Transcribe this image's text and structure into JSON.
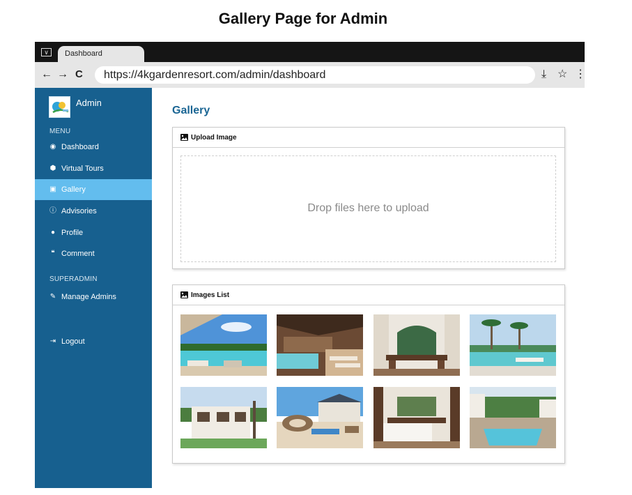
{
  "caption": "Gallery Page for Admin",
  "browser": {
    "tab_title": "Dashboard",
    "url": "https://4kgardenresort.com/admin/dashboard",
    "nav": {
      "back": "←",
      "forward": "→",
      "reload": "C"
    },
    "tools": {
      "download": "⤓",
      "bookmark": "☆",
      "more": "⋮"
    },
    "window_menu_icon": "∨"
  },
  "sidebar": {
    "brand": "Admin",
    "menu_label": "MENU",
    "items": [
      {
        "label": "Dashboard",
        "icon": "dashboard-icon",
        "glyph": "◉"
      },
      {
        "label": "Virtual Tours",
        "icon": "map-pin-icon",
        "glyph": "⬢"
      },
      {
        "label": "Gallery",
        "icon": "image-icon",
        "glyph": "▣",
        "active": true
      },
      {
        "label": "Advisories",
        "icon": "info-icon",
        "glyph": "ⓘ"
      },
      {
        "label": "Profile",
        "icon": "user-icon",
        "glyph": "●"
      },
      {
        "label": "Comment",
        "icon": "comments-icon",
        "glyph": "❝"
      }
    ],
    "superadmin_label": "SUPERADMIN",
    "manage_admins": {
      "label": "Manage Admins",
      "icon": "edit-icon",
      "glyph": "✎"
    },
    "logout": {
      "label": "Logout",
      "icon": "logout-icon",
      "glyph": "⇥"
    }
  },
  "main": {
    "title": "Gallery",
    "upload_card": {
      "title": "Upload Image",
      "dropzone_text": "Drop files here to upload"
    },
    "images_card": {
      "title": "Images List"
    }
  },
  "colors": {
    "sidebar": "#17608f",
    "active_item": "#63bdee",
    "title_blue": "#1b6694"
  }
}
